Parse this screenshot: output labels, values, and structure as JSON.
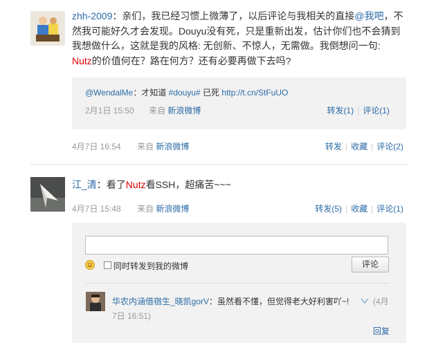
{
  "post1": {
    "author": "zhh-2009",
    "colon": "：",
    "text_a": "亲们，我已经习惯上微薄了，以后评论与我相关的直接",
    "mention": "@我吧",
    "text_b": "，不",
    "line2": "然我可能好久才会发现。Douyu没有死，只是重新出发，估计你们也不会猜到",
    "line3": "我想做什么，这就是我的风格: 无创新、不惊人，无需做。我倒想问一句:",
    "nutz": "Nutz",
    "line4_rest": "的价值何在？路在何方？还有必要再做下去吗?",
    "quote": {
      "author": "@WendalMe",
      "colon": "：才知道 ",
      "hashtag": "#douyu#",
      "after_tag": " 已死 ",
      "url": "http://t.cn/StFuUO",
      "time": "2月1日 15:50",
      "from_label": "来自",
      "source": "新浪微博",
      "repost": "转发(1)",
      "comment": "评论(1)"
    },
    "time": "4月7日 16:54",
    "from_label": "来自",
    "source": "新浪微博",
    "actions": {
      "repost": "转发",
      "favorite": "收藏",
      "comment": "评论(2)"
    }
  },
  "post2": {
    "author": "江_清",
    "colon": "：",
    "text_a": "看了",
    "nutz": "Nutz",
    "text_b": "看SSH，超痛苦~~~",
    "time": "4月7日 15:48",
    "from_label": "来自",
    "source": "新浪微博",
    "actions": {
      "repost": "转发(5)",
      "favorite": "收藏",
      "comment": "评论(1)"
    }
  },
  "reply_form": {
    "input_value": "",
    "checkbox_label": "同时转发到我的微博",
    "submit_label": "评论"
  },
  "comment": {
    "author": "华农内涵借宿生_晓凯gorV",
    "colon": "：",
    "text": "虽然看不懂，但觉得老大好利害吖~!",
    "time_a": "(4月",
    "time_b": "7日 16:51)",
    "reply_label": "回复"
  },
  "colors": {
    "link": "#2a6aa6",
    "highlight": "#e00000",
    "meta": "#999999"
  }
}
